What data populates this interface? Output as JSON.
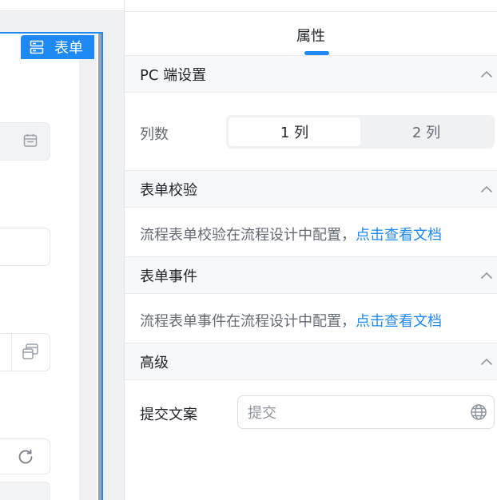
{
  "canvas": {
    "form_badge": {
      "label": "表单",
      "icon": "form-layout-icon"
    },
    "ghost_icons": [
      "calendar-icon",
      "copy-window-icon",
      "refresh-icon"
    ]
  },
  "panel": {
    "tab_title": "属性",
    "sections": {
      "pc": {
        "title": "PC 端设置",
        "columns_label": "列数",
        "options": [
          "1 列",
          "2 列"
        ],
        "selected": "1 列"
      },
      "validation": {
        "title": "表单校验",
        "text": "流程表单校验在流程设计中配置，",
        "link": "点击查看文档"
      },
      "events": {
        "title": "表单事件",
        "text": "流程表单事件在流程设计中配置，",
        "link": "点击查看文档"
      },
      "advanced": {
        "title": "高级",
        "submit_label": "提交文案",
        "submit_value": "提交",
        "submit_icon": "globe-icon"
      }
    }
  },
  "colors": {
    "accent": "#1e88f5",
    "section_bg": "#f7f8fa",
    "muted_text": "#646a73"
  }
}
